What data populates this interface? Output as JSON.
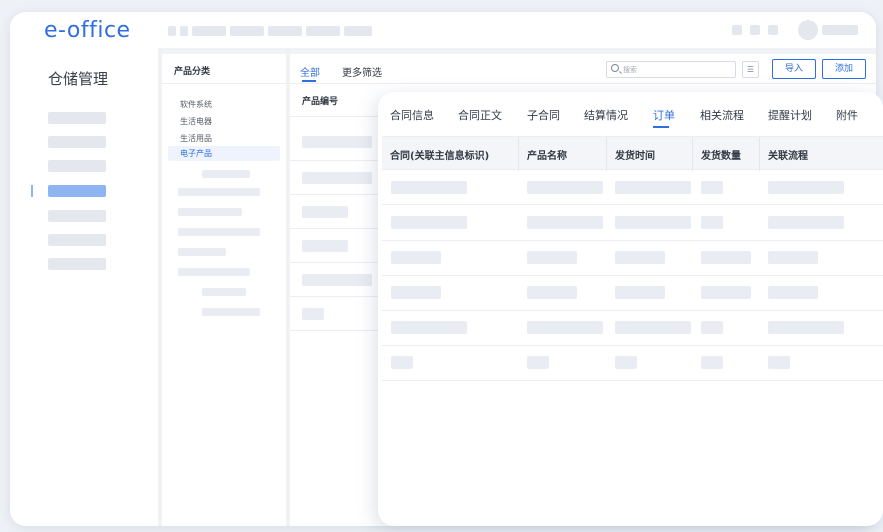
{
  "app": {
    "logo": "e-office"
  },
  "sidebar": {
    "module_title": "仓储管理"
  },
  "category_panel": {
    "title": "产品分类",
    "items": [
      "软件系统",
      "生活电器",
      "生活用品",
      "电子产品"
    ],
    "active_index": 3
  },
  "list_panel": {
    "tabs": {
      "all": "全部",
      "more_filter": "更多筛选"
    },
    "search": {
      "placeholder": "搜索"
    },
    "filter_icon": "filter-icon",
    "import_label": "导入",
    "add_label": "添加",
    "column_code": "产品编号"
  },
  "detail_popup": {
    "tabs": [
      "合同信息",
      "合同正文",
      "子合同",
      "结算情况",
      "订单",
      "相关流程",
      "提醒计划",
      "附件"
    ],
    "active_tab": "订单",
    "columns": [
      "合同(关联主信息标识)",
      "产品名称",
      "发货时间",
      "发货数量",
      "关联流程"
    ]
  },
  "colors": {
    "accent": "#2f6fe0",
    "placeholder": "#e4e7ee",
    "active_sidebar": "#8fb4f2"
  }
}
